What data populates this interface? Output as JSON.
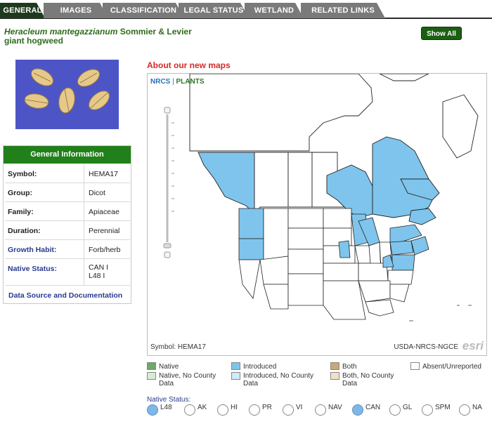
{
  "tabs": [
    {
      "label": "GENERAL",
      "active": true
    },
    {
      "label": "IMAGES",
      "active": false
    },
    {
      "label": "CLASSIFICATION",
      "active": false
    },
    {
      "label": "LEGAL STATUS",
      "active": false
    },
    {
      "label": "WETLAND",
      "active": false
    },
    {
      "label": "RELATED LINKS",
      "active": false
    }
  ],
  "header": {
    "scientific_name": "Heracleum mantegazzianum",
    "authority": "Sommier & Levier",
    "common_name": "giant hogweed",
    "show_all_label": "Show All"
  },
  "general_info": {
    "title": "General Information",
    "rows": [
      {
        "key": "Symbol:",
        "value": "HEMA17"
      },
      {
        "key": "Group:",
        "value": "Dicot"
      },
      {
        "key": "Family:",
        "value": "Apiaceae"
      },
      {
        "key": "Duration:",
        "value": "Perennial"
      },
      {
        "key": "Growth Habit:",
        "value": "Forb/herb"
      },
      {
        "key": "Native Status:",
        "value": "CAN I\nL48 I"
      }
    ],
    "data_source_link": "Data Source and Documentation"
  },
  "map": {
    "link_label": "About our new maps",
    "logo_nrcs": "NRCS",
    "logo_plants": "PLANTS",
    "symbol_text": "Symbol: HEMA17",
    "source_text": "USDA-NRCS-NGCE",
    "esri_text": "esri"
  },
  "legend": {
    "native": "Native",
    "native_no_county": "Native, No County Data",
    "introduced": "Introduced",
    "introduced_no_county": "Introduced, No County Data",
    "both": "Both",
    "both_no_county": "Both, No County Data",
    "absent": "Absent/Unreported",
    "colors": {
      "native": "#6aaa6a",
      "native_light": "#d8ecd4",
      "introduced": "#7fc4ec",
      "introduced_light": "#cfeaf8",
      "both": "#c9a978",
      "both_light": "#f1e0c4",
      "absent": "#ffffff"
    }
  },
  "native_status": {
    "title": "Native Status:",
    "options": [
      {
        "label": "L48",
        "selected": true
      },
      {
        "label": "AK",
        "selected": false
      },
      {
        "label": "HI",
        "selected": false
      },
      {
        "label": "PR",
        "selected": false
      },
      {
        "label": "VI",
        "selected": false
      },
      {
        "label": "NAV",
        "selected": false
      },
      {
        "label": "CAN",
        "selected": true
      },
      {
        "label": "GL",
        "selected": false
      },
      {
        "label": "SPM",
        "selected": false
      },
      {
        "label": "NA",
        "selected": false
      }
    ]
  }
}
